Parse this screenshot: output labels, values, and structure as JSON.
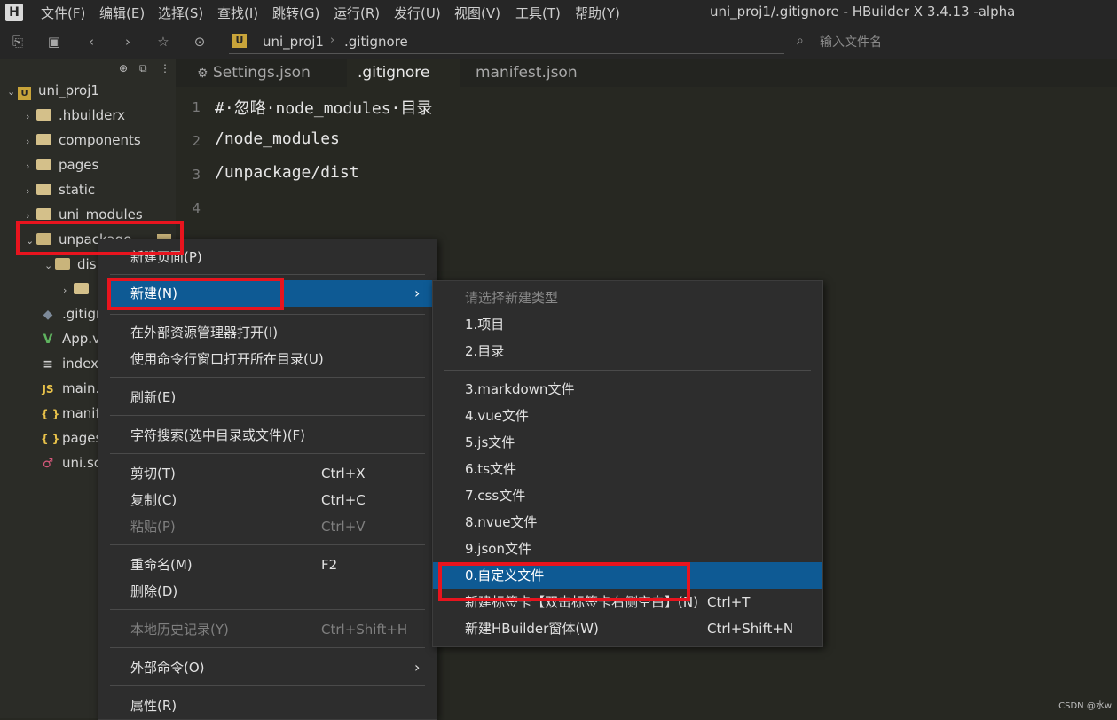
{
  "window": {
    "title": "uni_proj1/.gitignore - HBuilder X 3.4.13 -alpha",
    "logo": "H"
  },
  "menu": [
    "文件(F)",
    "编辑(E)",
    "选择(S)",
    "查找(I)",
    "跳转(G)",
    "运行(R)",
    "发行(U)",
    "视图(V)",
    "工具(T)",
    "帮助(Y)"
  ],
  "toolbar": {
    "breadcrumb_project": "uni_proj1",
    "breadcrumb_separator": "›",
    "breadcrumb_file": ".gitignore",
    "project_icon_letter": "U",
    "search_placeholder": "输入文件名"
  },
  "sidebar": {
    "root": "uni_proj1",
    "items": [
      {
        "label": ".hbuilderx",
        "type": "folder"
      },
      {
        "label": "components",
        "type": "folder"
      },
      {
        "label": "pages",
        "type": "folder"
      },
      {
        "label": "static",
        "type": "folder"
      },
      {
        "label": "uni_modules",
        "type": "folder"
      },
      {
        "label": "unpackage",
        "type": "folder-open"
      },
      {
        "label": "dis",
        "type": "folder-open"
      },
      {
        "label": "",
        "type": "folder"
      },
      {
        "label": ".gitigr",
        "type": "file"
      },
      {
        "label": "App.v",
        "type": "vue"
      },
      {
        "label": "index",
        "type": "file"
      },
      {
        "label": "main.",
        "type": "js"
      },
      {
        "label": "manif",
        "type": "json"
      },
      {
        "label": "pages",
        "type": "json"
      },
      {
        "label": "uni.sc",
        "type": "scss"
      }
    ],
    "icon_labels": {
      "js": "JS",
      "json": "{ }",
      "vue": "V"
    }
  },
  "tabs": [
    {
      "label": "Settings.json",
      "icon": "gear-icon",
      "active": false
    },
    {
      "label": ".gitignore",
      "active": true
    },
    {
      "label": "manifest.json",
      "active": false
    }
  ],
  "editor": {
    "lines": [
      {
        "num": "1",
        "text": "#·忽略·node_modules·目录"
      },
      {
        "num": "2",
        "text": "/node_modules"
      },
      {
        "num": "3",
        "text": "/unpackage/dist"
      },
      {
        "num": "4",
        "text": ""
      }
    ]
  },
  "context_menu": {
    "items": [
      {
        "label": "新建页面(P)",
        "shortcut": ""
      },
      {
        "label": "新建(N)",
        "shortcut": "",
        "submenu": true,
        "highlighted": true
      },
      {
        "label": "在外部资源管理器打开(I)",
        "shortcut": ""
      },
      {
        "label": "使用命令行窗口打开所在目录(U)",
        "shortcut": ""
      },
      {
        "label": "刷新(E)",
        "shortcut": ""
      },
      {
        "label": "字符搜索(选中目录或文件)(F)",
        "shortcut": ""
      },
      {
        "label": "剪切(T)",
        "shortcut": "Ctrl+X"
      },
      {
        "label": "复制(C)",
        "shortcut": "Ctrl+C"
      },
      {
        "label": "粘贴(P)",
        "shortcut": "Ctrl+V",
        "disabled": true
      },
      {
        "label": "重命名(M)",
        "shortcut": "F2"
      },
      {
        "label": "删除(D)",
        "shortcut": ""
      },
      {
        "label": "本地历史记录(Y)",
        "shortcut": "Ctrl+Shift+H",
        "disabled": true
      },
      {
        "label": "外部命令(O)",
        "shortcut": "",
        "submenu": true
      },
      {
        "label": "属性(R)",
        "shortcut": ""
      }
    ],
    "submenu_arrow": "›"
  },
  "submenu": {
    "items": [
      {
        "label": "请选择新建类型",
        "shortcut": "",
        "disabled": true
      },
      {
        "label": "1.项目",
        "shortcut": ""
      },
      {
        "label": "2.目录",
        "shortcut": ""
      },
      {
        "label": "3.markdown文件",
        "shortcut": ""
      },
      {
        "label": "4.vue文件",
        "shortcut": ""
      },
      {
        "label": "5.js文件",
        "shortcut": ""
      },
      {
        "label": "6.ts文件",
        "shortcut": ""
      },
      {
        "label": "7.css文件",
        "shortcut": ""
      },
      {
        "label": "8.nvue文件",
        "shortcut": ""
      },
      {
        "label": "9.json文件",
        "shortcut": ""
      },
      {
        "label": "0.自定义文件",
        "shortcut": "",
        "highlighted": true
      },
      {
        "label": "新建标签卡【双击标签卡右侧空白】(N)",
        "shortcut": "Ctrl+T"
      },
      {
        "label": "新建HBuilder窗体(W)",
        "shortcut": "Ctrl+Shift+N"
      }
    ]
  },
  "watermark": "CSDN @水w",
  "colors": {
    "highlight": "#0e5a94",
    "annotation_red": "#e8141e",
    "folder": "#d4c08a"
  }
}
